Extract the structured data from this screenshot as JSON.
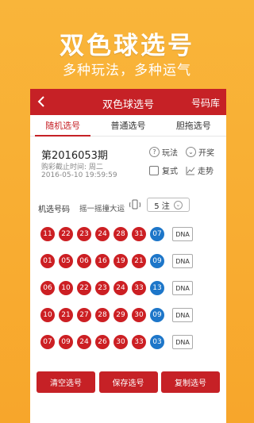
{
  "promo": {
    "title": "双色球选号",
    "subtitle": "多种玩法，多种运气"
  },
  "header": {
    "title": "双色球选号",
    "right_link": "号码库"
  },
  "tabs": [
    {
      "label": "随机选号",
      "active": true
    },
    {
      "label": "普通选号",
      "active": false
    },
    {
      "label": "胆拖选号",
      "active": false
    }
  ],
  "draw": {
    "issue": "第2016053期",
    "deadline_label": "购彩截止时间: 周二",
    "deadline_time": "2016-05-10 19:59:59"
  },
  "options": {
    "rules": "玩法",
    "results": "开奖",
    "multiple": "复式",
    "trend": "走势"
  },
  "machine": {
    "label": "机选号码",
    "shake_hint": "摇一摇撞大运",
    "bet_count": "5 注"
  },
  "picks": [
    {
      "red": [
        "11",
        "22",
        "23",
        "24",
        "28",
        "31"
      ],
      "blue": "07"
    },
    {
      "red": [
        "01",
        "05",
        "06",
        "16",
        "19",
        "21"
      ],
      "blue": "09"
    },
    {
      "red": [
        "06",
        "10",
        "22",
        "23",
        "24",
        "33"
      ],
      "blue": "13"
    },
    {
      "red": [
        "10",
        "21",
        "27",
        "28",
        "29",
        "30"
      ],
      "blue": "09"
    },
    {
      "red": [
        "07",
        "09",
        "24",
        "26",
        "30",
        "33"
      ],
      "blue": "03"
    }
  ],
  "dna_label": "DNA",
  "buttons": {
    "clear": "清空选号",
    "save": "保存选号",
    "copy": "复制选号"
  },
  "colors": {
    "accent_red": "#c62126",
    "ball_red": "#cc1f23",
    "ball_blue": "#1d76c9",
    "background_orange": "#f8ad33"
  }
}
